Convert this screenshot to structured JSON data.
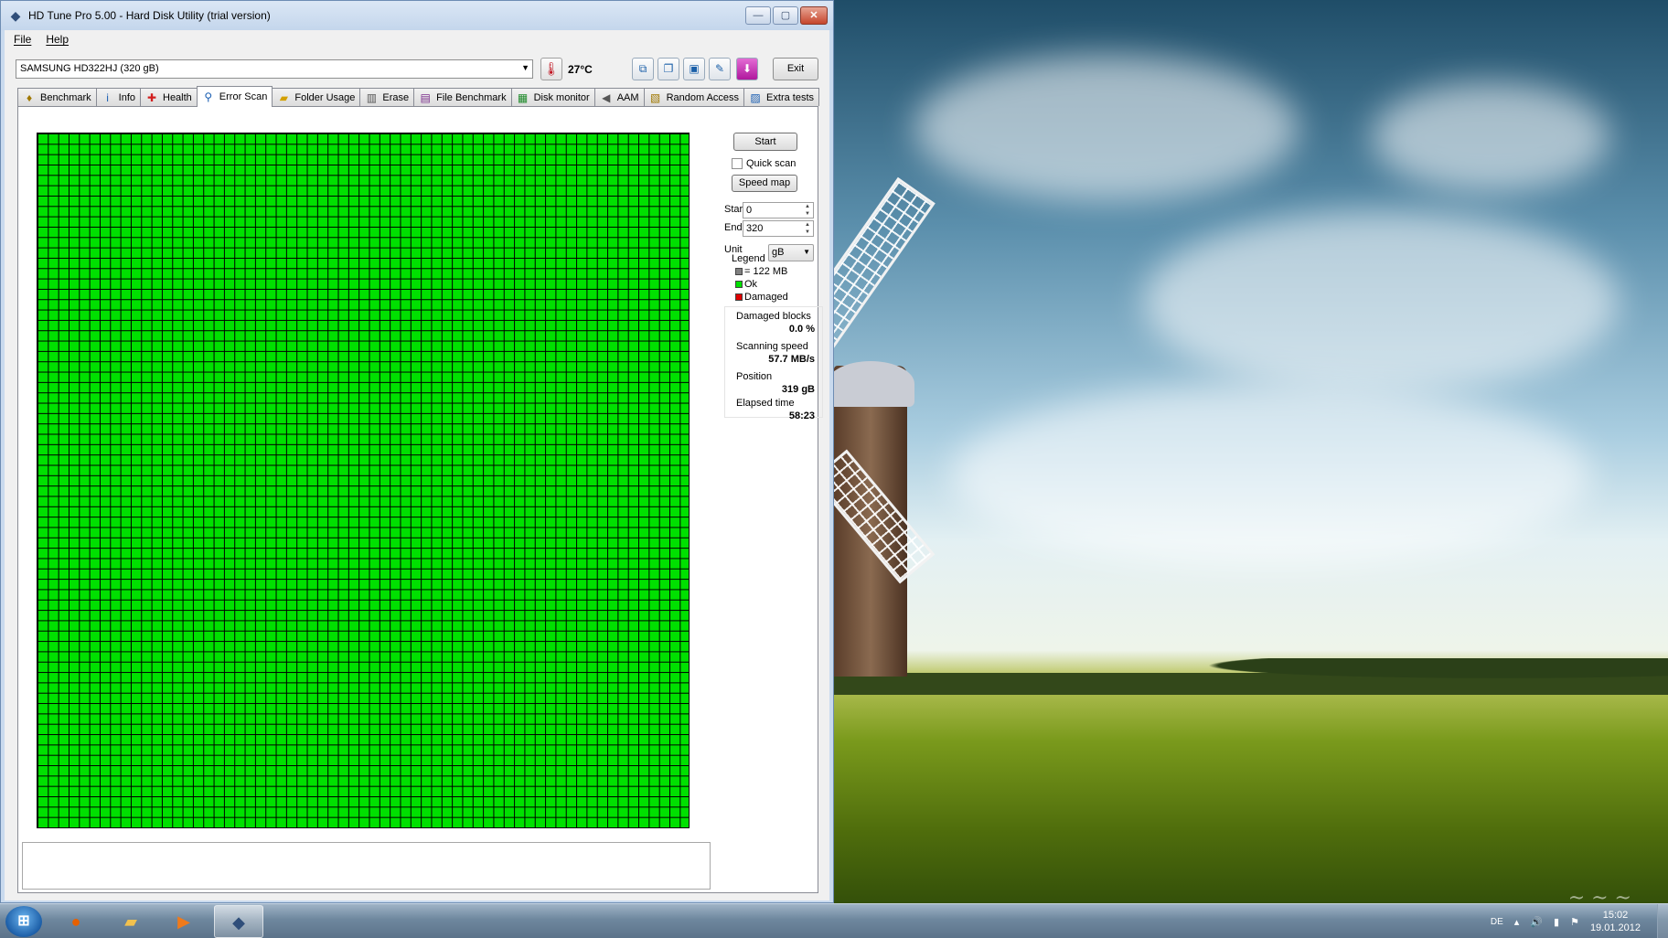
{
  "window": {
    "title": "HD Tune Pro 5.00 - Hard Disk Utility (trial version)"
  },
  "menu": {
    "file": "File",
    "help": "Help"
  },
  "toolbar": {
    "drive": "SAMSUNG HD322HJ (320 gB)",
    "temperature": "27°C",
    "exit_label": "Exit"
  },
  "tabs": [
    {
      "label": "Benchmark",
      "icon": "benchmark-icon"
    },
    {
      "label": "Info",
      "icon": "info-icon"
    },
    {
      "label": "Health",
      "icon": "health-cross-icon"
    },
    {
      "label": "Error Scan",
      "icon": "magnifier-icon"
    },
    {
      "label": "Folder Usage",
      "icon": "folder-icon"
    },
    {
      "label": "Erase",
      "icon": "trash-icon"
    },
    {
      "label": "File Benchmark",
      "icon": "file-benchmark-icon"
    },
    {
      "label": "Disk monitor",
      "icon": "chart-icon"
    },
    {
      "label": "AAM",
      "icon": "speaker-icon"
    },
    {
      "label": "Random Access",
      "icon": "random-access-icon"
    },
    {
      "label": "Extra tests",
      "icon": "extra-tests-icon"
    }
  ],
  "active_tab": "Error Scan",
  "error_scan": {
    "start_label": "Start",
    "quick_scan_label": "Quick scan",
    "quick_scan_checked": false,
    "speed_map_label": "Speed map",
    "start_field_label": "Start",
    "start_value": "0",
    "end_field_label": "End",
    "end_value": "320",
    "unit_label": "Unit",
    "unit_value": "gB",
    "legend": {
      "title": "Legend",
      "block_size": "= 122 MB",
      "ok": "Ok",
      "damaged": "Damaged",
      "ok_color": "#00e000",
      "damaged_color": "#e00000",
      "block_color": "#808080"
    },
    "stats": {
      "damaged_blocks_label": "Damaged blocks",
      "damaged_blocks_value": "0.0 %",
      "scanning_speed_label": "Scanning speed",
      "scanning_speed_value": "57.7 MB/s",
      "position_label": "Position",
      "position_value": "319 gB",
      "elapsed_label": "Elapsed time",
      "elapsed_value": "58:23"
    }
  },
  "taskbar": {
    "language": "DE",
    "time": "15:02",
    "date": "19.01.2012"
  }
}
